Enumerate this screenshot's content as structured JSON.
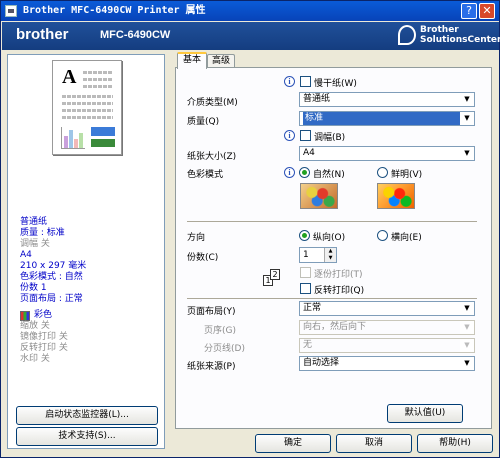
{
  "window": {
    "title": "Brother MFC-6490CW Printer 属性",
    "help_button": "?",
    "close_button": "✕"
  },
  "banner": {
    "brand": "brother",
    "model": "MFC-6490CW",
    "logo_line1": "Brother",
    "logo_line2": "SolutionsCenter"
  },
  "preview": {
    "summary_blue": [
      "普通纸",
      "质量 : 标准"
    ],
    "summary_gray1": [
      "调幅 关"
    ],
    "summary_blue2": [
      "A4",
      "210 x 297 毫米",
      "色彩模式 : 自然",
      "份数 1",
      "页面布局 : 正常"
    ],
    "color_label": "彩色",
    "summary_gray2": [
      "缩放 关",
      "镜像打印 关",
      "反转打印 关",
      "水印 关"
    ]
  },
  "left_buttons": {
    "status_monitor": "启动状态监控器(L)...",
    "support": "技术支持(S)..."
  },
  "tabs": [
    "基本",
    "高级"
  ],
  "basic": {
    "slow_dry_paper": "慢干纸(W)",
    "media_type_label": "介质类型(M)",
    "media_type_value": "普通纸",
    "quality_label": "质量(Q)",
    "quality_value": "标准",
    "bi_directional": "调幅(B)",
    "paper_size_label": "纸张大小(Z)",
    "paper_size_value": "A4",
    "color_mode_label": "色彩模式",
    "color_natural": "自然(N)",
    "color_vivid": "鲜明(V)",
    "orientation_label": "方向",
    "portrait": "纵向(O)",
    "landscape": "横向(E)",
    "copies_label": "份数(C)",
    "copies_value": "1",
    "collate": "逐份打印(T)",
    "reverse_order": "反转打印(Q)",
    "page_layout_label": "页面布局(Y)",
    "page_layout_value": "正常",
    "page_order_label": "页序(G)",
    "page_order_value": "向右，然后向下",
    "border_line_label": "分页线(D)",
    "border_line_value": "无",
    "paper_source_label": "纸张来源(P)",
    "paper_source_value": "自动选择",
    "default_button": "默认值(U)"
  },
  "footer": {
    "ok": "确定",
    "cancel": "取消",
    "help": "帮助(H)"
  }
}
